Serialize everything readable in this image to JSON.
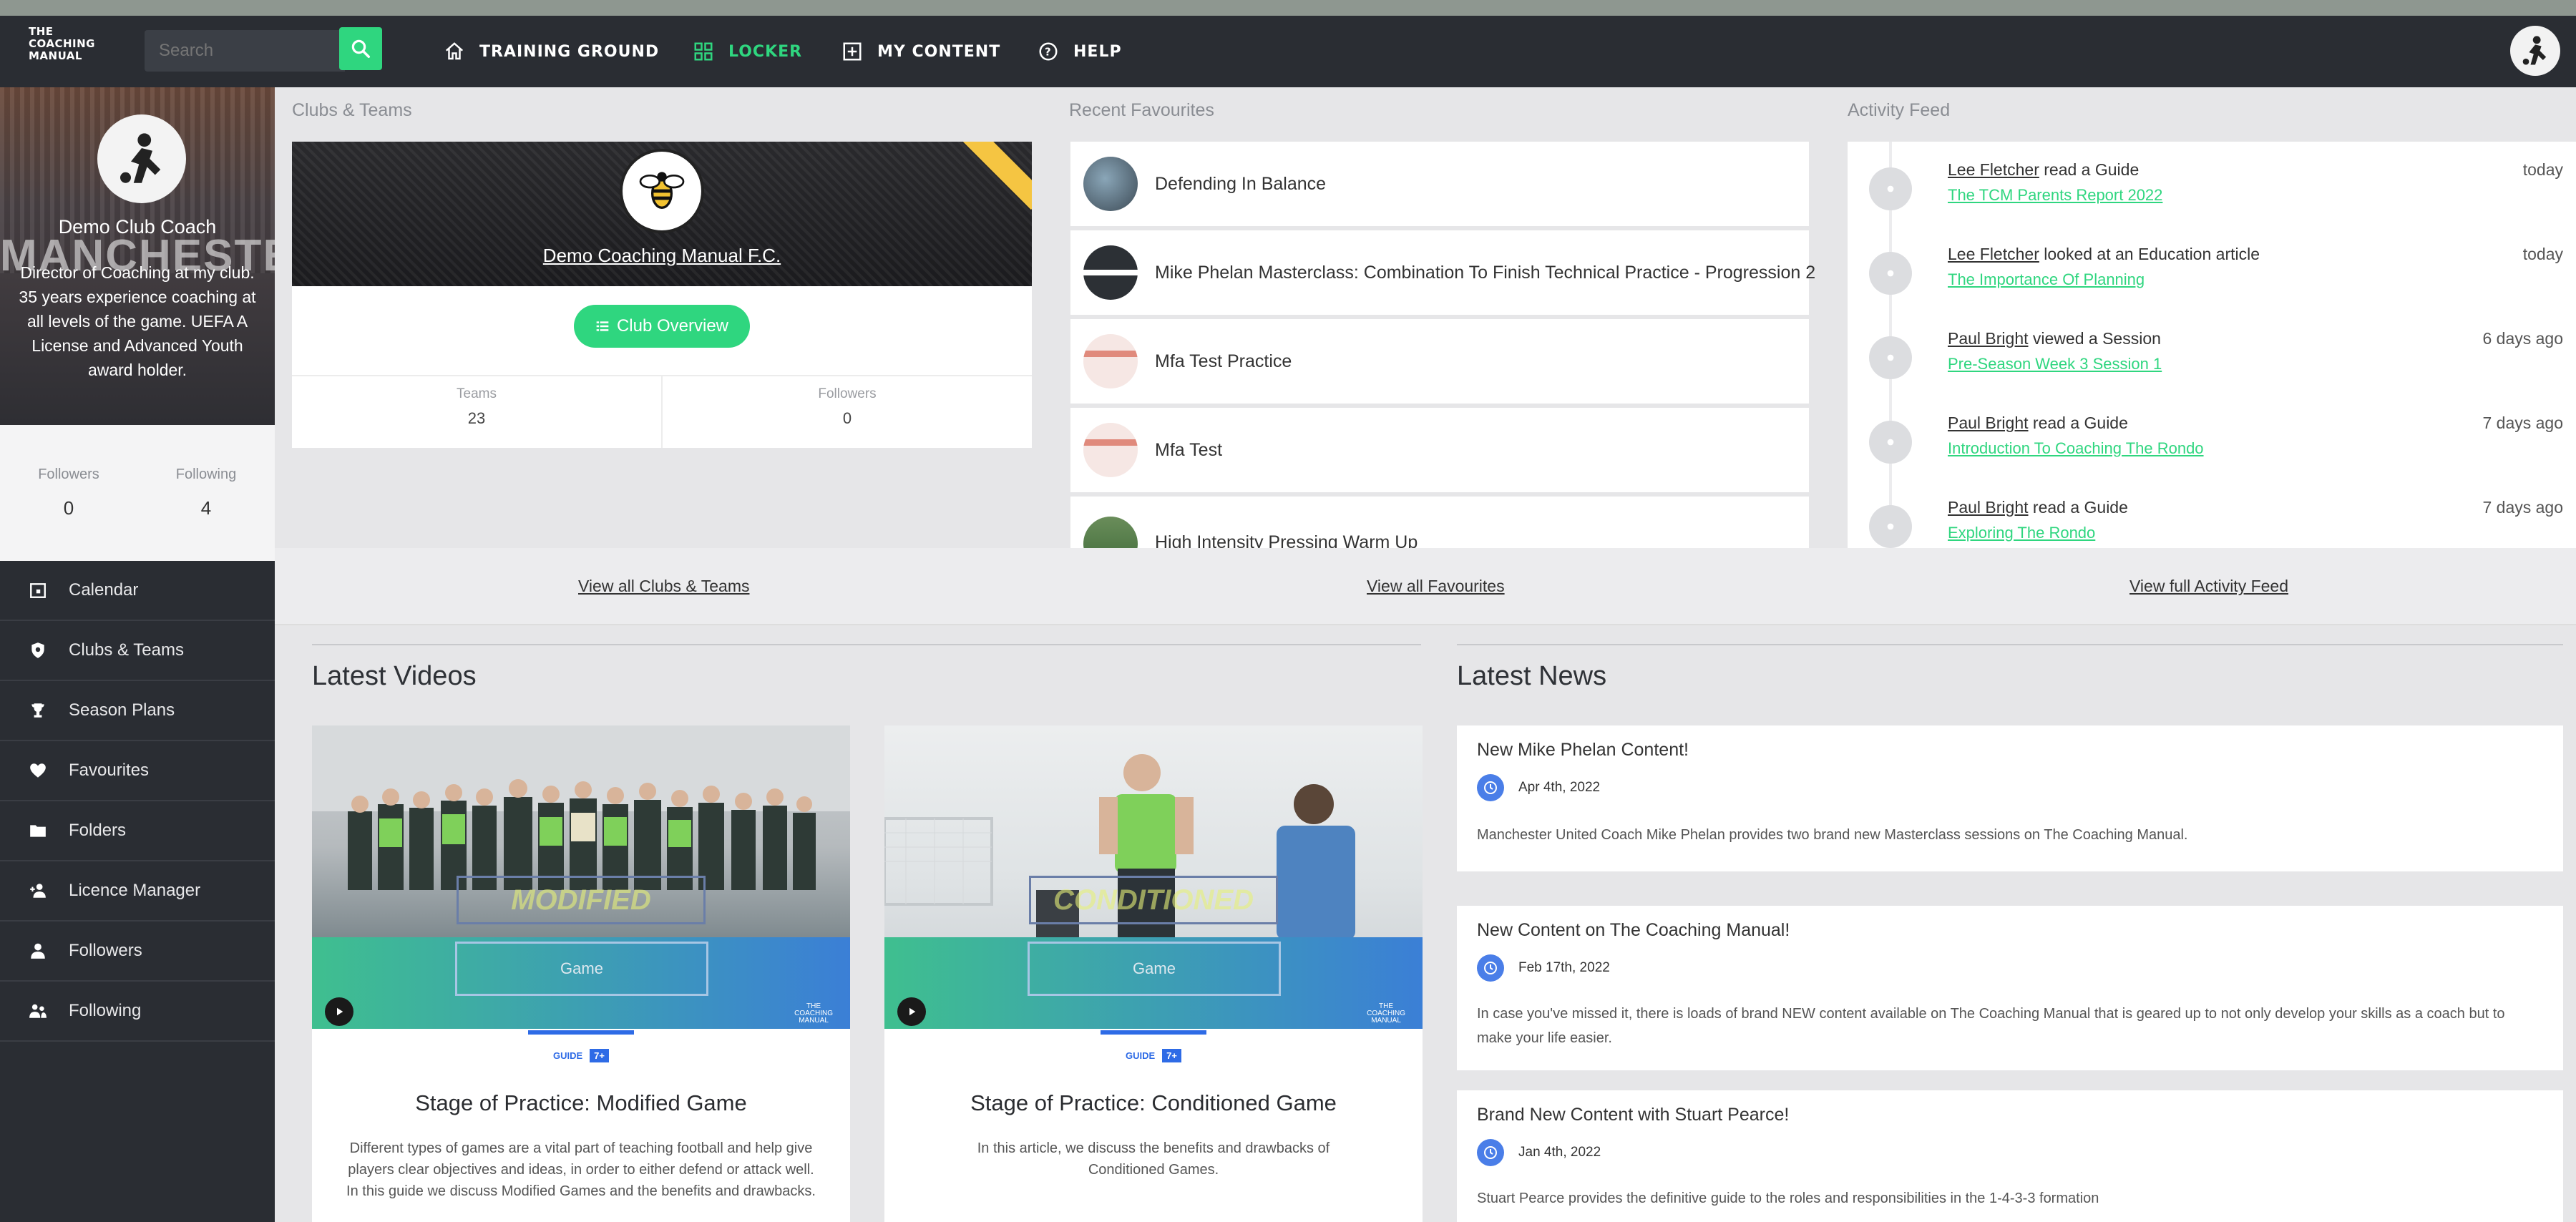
{
  "logo": {
    "line1": "THE",
    "line2": "COACHING",
    "line3": "MANUAL"
  },
  "search": {
    "placeholder": "Search"
  },
  "nav": [
    {
      "label": "TRAINING GROUND",
      "icon": "home-icon"
    },
    {
      "label": "LOCKER",
      "icon": "grid-icon",
      "active": true
    },
    {
      "label": "MY CONTENT",
      "icon": "plus-square-icon"
    },
    {
      "label": "HELP",
      "icon": "help-circle-icon"
    }
  ],
  "profile": {
    "name": "Demo Club Coach",
    "watermark": "MANCHESTER",
    "bio": "Director of Coaching at my club. 35 years experience coaching at all levels of the game. UEFA A License and Advanced Youth award holder.",
    "followers_label": "Followers",
    "followers_value": "0",
    "following_label": "Following",
    "following_value": "4"
  },
  "side_menu": [
    {
      "label": "Calendar",
      "icon": "calendar-icon"
    },
    {
      "label": "Clubs & Teams",
      "icon": "shield-icon"
    },
    {
      "label": "Season Plans",
      "icon": "trophy-icon"
    },
    {
      "label": "Favourites",
      "icon": "heart-icon"
    },
    {
      "label": "Folders",
      "icon": "folder-icon"
    },
    {
      "label": "Licence Manager",
      "icon": "add-user-icon"
    },
    {
      "label": "Followers",
      "icon": "user-icon"
    },
    {
      "label": "Following",
      "icon": "users-icon"
    }
  ],
  "columns": {
    "clubs": "Clubs & Teams",
    "favourites": "Recent Favourites",
    "activity": "Activity Feed"
  },
  "club": {
    "name": "Demo Coaching Manual F.C.",
    "overview_label": "Club Overview",
    "teams_label": "Teams",
    "teams_value": "23",
    "followers_label": "Followers",
    "followers_value": "0"
  },
  "favourites": [
    {
      "title": "Defending In Balance"
    },
    {
      "title": "Mike Phelan Masterclass: Combination To Finish Technical Practice - Progression 2"
    },
    {
      "title": "Mfa Test Practice"
    },
    {
      "title": "Mfa Test"
    },
    {
      "title": "High Intensity Pressing Warm Up"
    }
  ],
  "activity": [
    {
      "who": "Lee Fletcher",
      "action": "read a Guide",
      "link": "The TCM Parents Report 2022",
      "time": "today"
    },
    {
      "who": "Lee Fletcher",
      "action": "looked at an Education article",
      "link": "The Importance Of Planning",
      "time": "today"
    },
    {
      "who": "Paul Bright",
      "action": "viewed a Session",
      "link": "Pre-Season Week 3 Session 1",
      "time": "6 days ago"
    },
    {
      "who": "Paul Bright",
      "action": "read a Guide",
      "link": "Introduction To Coaching The Rondo",
      "time": "7 days ago"
    },
    {
      "who": "Paul Bright",
      "action": "read a Guide",
      "link": "Exploring The Rondo",
      "time": "7 days ago"
    }
  ],
  "view_links": {
    "clubs": "View all Clubs & Teams",
    "favourites": "View all Favourites",
    "activity": "View full Activity Feed"
  },
  "videos_title": "Latest Videos",
  "news_title": "Latest News",
  "videos": [
    {
      "overlay": "MODIFIED",
      "button": "Game",
      "badge": "GUIDE",
      "badge_tag": "7+",
      "title": "Stage of Practice: Modified Game",
      "description": "Different types of games are a vital part of teaching football and help give players clear objectives and ideas, in order to either defend or attack well. In this guide we discuss Modified Games and the benefits and drawbacks."
    },
    {
      "overlay": "CONDITIONED",
      "button": "Game",
      "badge": "GUIDE",
      "badge_tag": "7+",
      "title": "Stage of Practice: Conditioned Game",
      "description": "In this article, we discuss the benefits and drawbacks of Conditioned Games."
    }
  ],
  "news": [
    {
      "title": "New Mike Phelan Content!",
      "date": "Apr 4th, 2022",
      "body": "Manchester United Coach Mike Phelan provides two brand new Masterclass sessions on The Coaching Manual."
    },
    {
      "title": "New Content on The Coaching Manual!",
      "date": "Feb 17th, 2022",
      "body": "In case you've missed it, there is loads of brand NEW content available on The Coaching Manual that is geared up to not only develop your skills as a coach but to make your life easier."
    },
    {
      "title": "Brand New Content with Stuart Pearce!",
      "date": "Jan 4th, 2022",
      "body": "Stuart Pearce provides the definitive guide to the roles and responsibilities in the 1-4-3-3 formation"
    }
  ],
  "colors": {
    "accent": "#2fd67f",
    "topbar": "#2a2d33",
    "link_blue": "#2e6be6",
    "news_icon": "#4a7ee8"
  }
}
